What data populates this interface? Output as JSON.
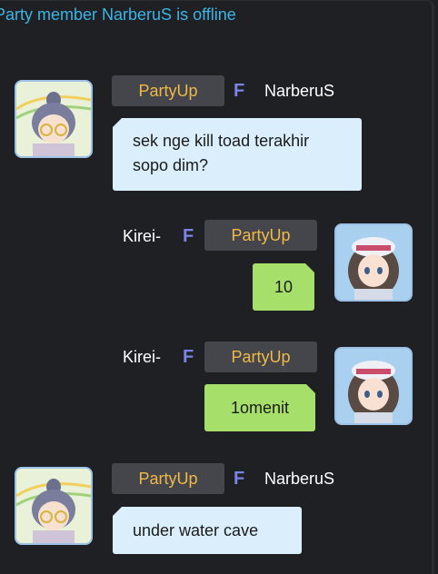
{
  "system_message": "Party member NarberuS is offline",
  "messages": [
    {
      "sender": "NarberuS",
      "channel": "PartyUp",
      "friend_mark": "F",
      "text": "sek nge kill toad terakhir sopo dim?"
    },
    {
      "sender": "Kirei-",
      "channel": "PartyUp",
      "friend_mark": "F",
      "text": "10"
    },
    {
      "sender": "Kirei-",
      "channel": "PartyUp",
      "friend_mark": "F",
      "text": "1omenit"
    },
    {
      "sender": "NarberuS",
      "channel": "PartyUp",
      "friend_mark": "F",
      "text": "under water cave"
    }
  ],
  "colors": {
    "background": "#1f2023",
    "system_text": "#3ab5e6",
    "channel_tag": "#f0b948",
    "friend_mark": "#7b83e6",
    "incoming_bubble": "#dbeefc",
    "outgoing_bubble": "#a6e06a"
  }
}
